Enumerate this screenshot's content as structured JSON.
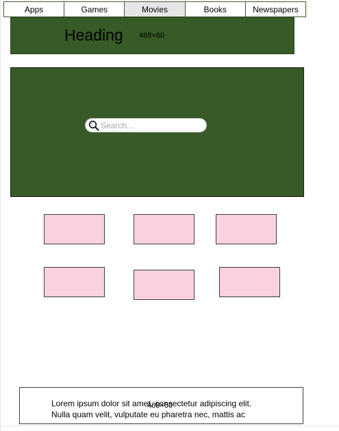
{
  "tabs": [
    {
      "label": "Apps",
      "active": false
    },
    {
      "label": "Games",
      "active": false
    },
    {
      "label": "Movies",
      "active": true
    },
    {
      "label": "Books",
      "active": false
    },
    {
      "label": "Newspapers",
      "active": false
    }
  ],
  "banner": {
    "title": "Heading",
    "size_label": "468×60"
  },
  "search": {
    "placeholder": "Search...",
    "value": ""
  },
  "cards_count": 6,
  "footer": {
    "line1": "Lorem ipsum dolor sit amet, consectetur adipiscing elit.",
    "line2": "Nulla quam velit, vulputate eu pharetra nec, mattis ac",
    "size_label": "468×60"
  },
  "colors": {
    "banner": "#375a26",
    "card": "#f9d2de",
    "active_tab": "#e6e6e6"
  },
  "icons": [
    "search-icon"
  ]
}
